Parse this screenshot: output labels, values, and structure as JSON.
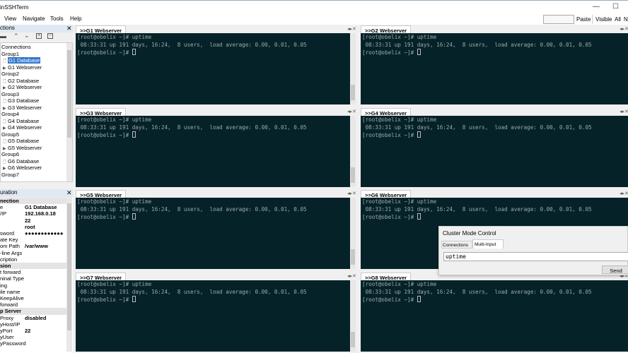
{
  "window": {
    "title": "inSSHTerm",
    "minimize": "—",
    "maximize": "☐"
  },
  "menu": [
    "View",
    "Navigate",
    "Tools",
    "Help"
  ],
  "toolbar": {
    "input_value": "",
    "paste": "Paste",
    "visible": "Visible",
    "all": "All",
    "n": "N"
  },
  "connections": {
    "title": "ctions",
    "close": "✕",
    "tree": [
      {
        "label": "Connections",
        "type": "root"
      },
      {
        "label": "Group1",
        "type": "group"
      },
      {
        "label": "G1 Database",
        "type": "leaf",
        "selected": true
      },
      {
        "label": "G1 Webserver",
        "type": "play"
      },
      {
        "label": "Group2",
        "type": "group"
      },
      {
        "label": "G2 Database",
        "type": "leaf"
      },
      {
        "label": "G2 Webserver",
        "type": "play"
      },
      {
        "label": "Group3",
        "type": "group"
      },
      {
        "label": "G3 Database",
        "type": "leaf"
      },
      {
        "label": "G3 Webserver",
        "type": "play"
      },
      {
        "label": "Group4",
        "type": "group"
      },
      {
        "label": "G4 Database",
        "type": "leaf"
      },
      {
        "label": "G4 Webserver",
        "type": "play"
      },
      {
        "label": "Group5",
        "type": "group"
      },
      {
        "label": "G5 Database",
        "type": "leaf"
      },
      {
        "label": "G5 Webserver",
        "type": "play"
      },
      {
        "label": "Group6",
        "type": "group"
      },
      {
        "label": "G6 Database",
        "type": "leaf"
      },
      {
        "label": "G6 Webserver",
        "type": "play"
      },
      {
        "label": "Group7",
        "type": "group"
      }
    ]
  },
  "configuration": {
    "title": "uration",
    "close": "✕",
    "rows": [
      {
        "k": "nection",
        "cat": true
      },
      {
        "k": "e",
        "v": "G1 Database"
      },
      {
        "k": "/IP",
        "v": "192.168.0.18"
      },
      {
        "k": "",
        "v": "22"
      },
      {
        "k": "",
        "v": "root"
      },
      {
        "k": "sword",
        "v": "●●●●●●●●●●●●"
      },
      {
        "k": "ate Key",
        "v": ""
      },
      {
        "k": "om Path",
        "v": "/var/www"
      },
      {
        "k": "-line Args",
        "v": ""
      },
      {
        "k": "cription",
        "v": ""
      },
      {
        "k": "sion",
        "cat": true
      },
      {
        "k": "t forward",
        "v": ""
      },
      {
        "k": "ninal Type",
        "v": ""
      },
      {
        "k": "ing",
        "v": ""
      },
      {
        "k": "ile name",
        "v": ""
      },
      {
        "k": "KeepAlive",
        "v": ""
      },
      {
        "k": "forward",
        "v": ""
      },
      {
        "k": "p Server",
        "cat": true
      },
      {
        "k": " Proxy",
        "v": "disabled"
      },
      {
        "k": "yHost/IP",
        "v": ""
      },
      {
        "k": "yPort",
        "v": "22"
      },
      {
        "k": "yUser",
        "v": ""
      },
      {
        "k": "yPassword",
        "v": ""
      }
    ]
  },
  "terminals": [
    {
      "tab": ">>G1 Webserver"
    },
    {
      "tab": ">>G2 Webserver"
    },
    {
      "tab": ">>G3 Webserver"
    },
    {
      "tab": ">>G4 Webserver"
    },
    {
      "tab": ">>G5 Webserver"
    },
    {
      "tab": ">>G6 Webserver"
    },
    {
      "tab": ">>G7 Webserver"
    },
    {
      "tab": ">>G8 Webserver"
    }
  ],
  "terminal_lines": {
    "cmd": "[root@obelix ~]# uptime",
    "out": " 08:33:31 up 191 days, 16:24,  8 users,  load average: 0.00, 0.01, 0.05",
    "prompt": "[root@obelix ~]# "
  },
  "cluster": {
    "title": "Cluster Mode Control",
    "tabs": [
      "Connections",
      "Multi-Input"
    ],
    "input": "uptime",
    "send": "Send"
  }
}
